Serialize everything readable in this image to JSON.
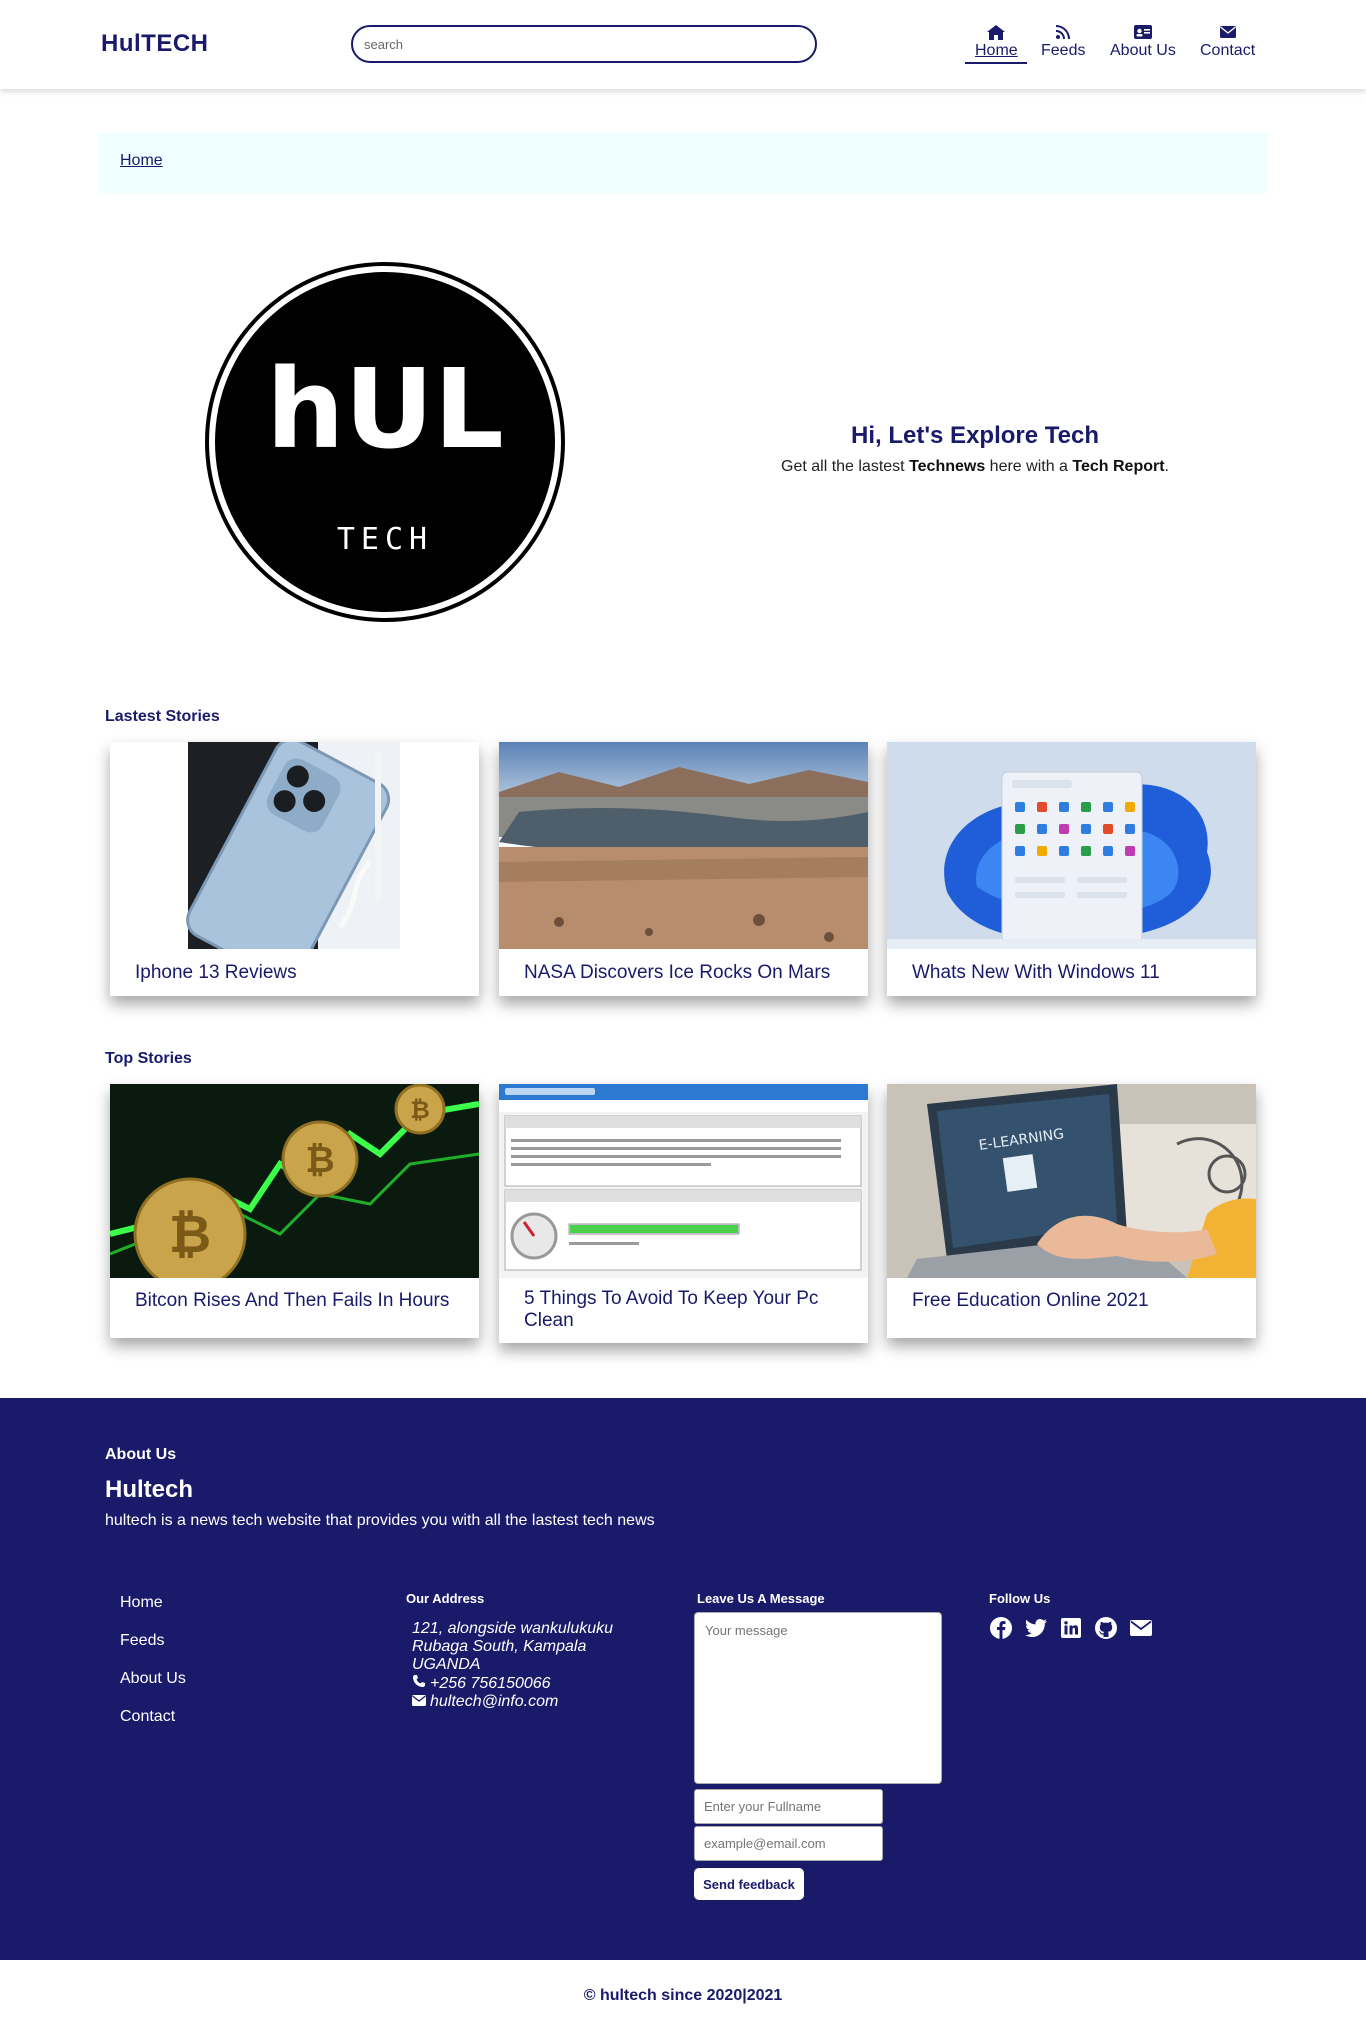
{
  "header": {
    "brand": "HulTECH",
    "search_placeholder": "search",
    "nav": [
      {
        "label": "Home",
        "icon": "home-icon"
      },
      {
        "label": "Feeds",
        "icon": "rss-icon"
      },
      {
        "label": "About Us",
        "icon": "id-card-icon"
      },
      {
        "label": "Contact",
        "icon": "envelope-icon"
      }
    ]
  },
  "breadcrumb": {
    "home": "Home"
  },
  "hero": {
    "title": "Hi, Let's Explore Tech",
    "subtitle_pre": "Get all the lastest ",
    "subtitle_bold1": "Technews",
    "subtitle_mid": " here with a ",
    "subtitle_bold2": "Tech Report",
    "subtitle_end": ".",
    "logo_text_top": "hUL",
    "logo_text_bottom": "TECH"
  },
  "latest": {
    "heading": "Lastest Stories",
    "cards": [
      {
        "title": "Iphone 13 Reviews"
      },
      {
        "title": "NASA Discovers Ice Rocks On Mars"
      },
      {
        "title": "Whats New With Windows 11"
      }
    ]
  },
  "top": {
    "heading": "Top Stories",
    "cards": [
      {
        "title": "Bitcon Rises And Then Fails In Hours"
      },
      {
        "title": "5 Things To Avoid To Keep Your Pc Clean"
      },
      {
        "title": "Free Education Online 2021"
      }
    ]
  },
  "footer": {
    "about_heading": "About Us",
    "brand": "Hultech",
    "description": "hultech is a news tech website that provides you with all the lastest tech news",
    "links": [
      "Home",
      "Feeds",
      "About Us",
      "Contact"
    ],
    "address_heading": "Our Address",
    "address_line1": "121, alongside wankulukuku",
    "address_line2": "Rubaga South, Kampala",
    "address_line3": "UGANDA",
    "phone": "+256 756150066",
    "email": "hultech@info.com",
    "message_heading": "Leave Us A Message",
    "message_placeholder": "Your message",
    "name_placeholder": "Enter your Fullname",
    "email_placeholder": "example@email.com",
    "send_label": "Send feedback",
    "follow_heading": "Follow Us",
    "social_icons": [
      "facebook-icon",
      "twitter-icon",
      "linkedin-icon",
      "github-icon",
      "envelope-icon"
    ]
  },
  "copyright": "© hultech since 2020|2021",
  "colors": {
    "primary": "#1a1a6b",
    "breadcrumb_bg": "#f0ffff",
    "white": "#ffffff"
  }
}
